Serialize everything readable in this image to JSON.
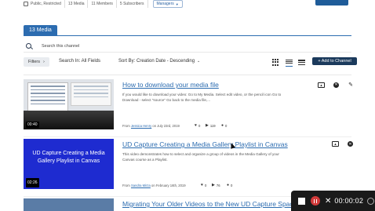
{
  "topbar": {
    "privacy": "Public, Restricted",
    "media_count": "13",
    "media_label": "Media",
    "members_count": "11",
    "members_label": "Members",
    "subscribers_count": "5",
    "subscribers_label": "Subscribers",
    "managers_label": "Managers"
  },
  "tab": {
    "label": "13 Media"
  },
  "search": {
    "placeholder": "Search this channel"
  },
  "toolbar": {
    "filters_label": "Filters",
    "search_in": "Search In: All Fields",
    "sort_by": "Sort By: Creation Date - Descending",
    "add_label": "+ Add to Channel"
  },
  "entries": [
    {
      "title": "How to download your media file",
      "description": "If you would like to download your video: Go to My Media. Select edit video, or the pencil icon Go to Download - select \"source\" Go back to the media file,...",
      "duration": "00:40",
      "from_label": "From",
      "author": "Jessica Henry",
      "date": "on July 23rd, 2019",
      "likes": "0",
      "plays": "119",
      "comments": "0"
    },
    {
      "title": "UD Capture Creating a Media Gallery Playlist in Canvas",
      "description": "This video demonstrates how to select and organize a group of videos in the Media Gallery of your Canvas course as a Playlist.",
      "duration": "02:26",
      "thumb_text": "UD Capture Creating a Media Gallery Playlist in Canvas",
      "from_label": "From",
      "author": "Sandra Mirza",
      "date": "on February 16th, 2019",
      "likes": "0",
      "plays": "76",
      "comments": "0"
    },
    {
      "title": "Migrating Your Older Videos to the New UD Capture Space"
    }
  ],
  "recorder": {
    "time": "00:00:02"
  },
  "icons": [
    "lock-icon",
    "chevron-down-icon",
    "search-icon",
    "chevron-right-icon",
    "grid-view-icon",
    "list-view-icon",
    "detailed-list-icon",
    "image-icon",
    "remove-icon",
    "edit-icon",
    "heart-icon",
    "play-icon",
    "comment-icon",
    "stop-icon",
    "pause-icon",
    "close-icon",
    "settings-icon",
    "cursor-icon"
  ],
  "colors": {
    "accent": "#2c6cb0",
    "dark": "#1b3a5c",
    "record": "#d23a3a"
  }
}
